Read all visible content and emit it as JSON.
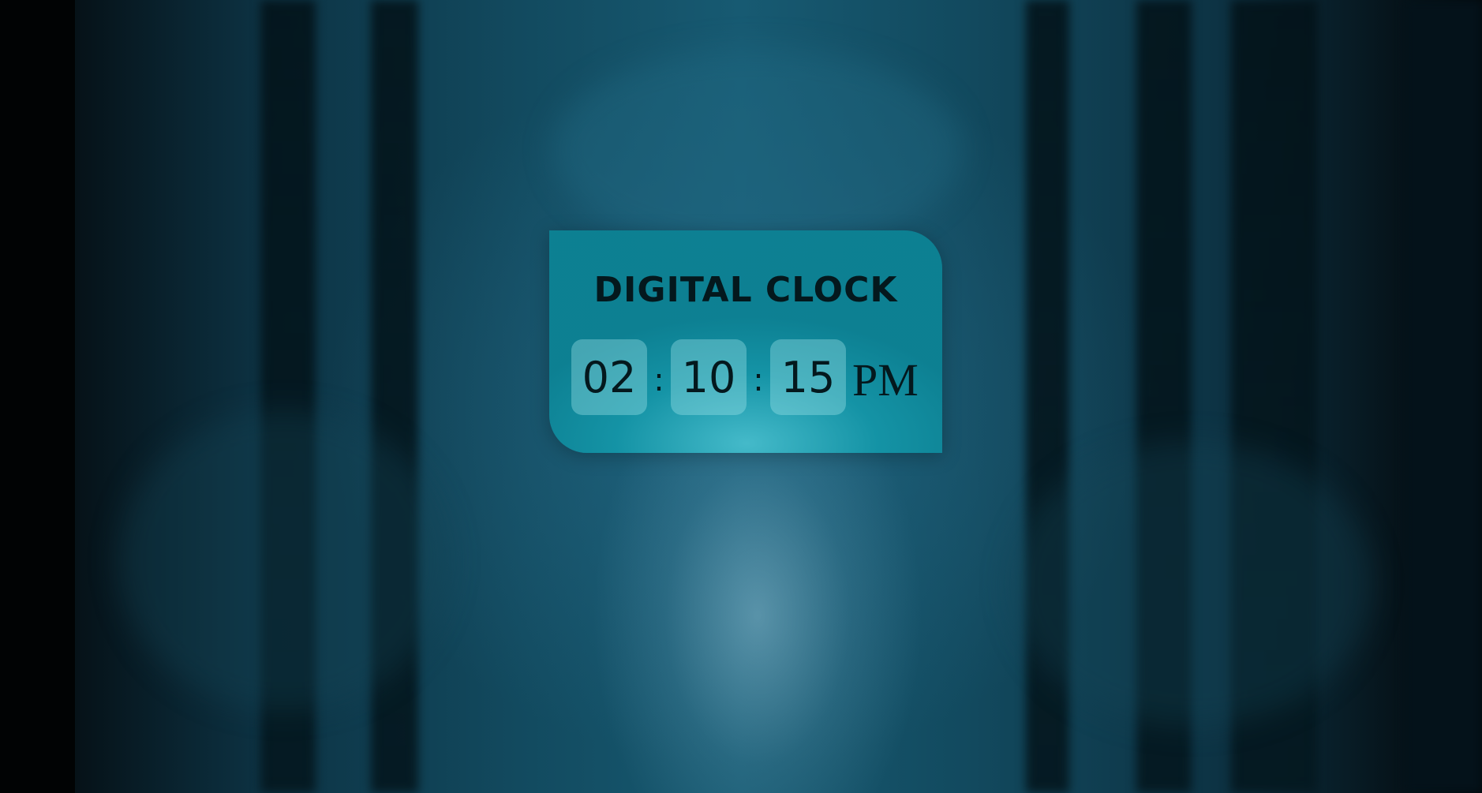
{
  "clock": {
    "title": "DIGITAL CLOCK",
    "hours": "02",
    "minutes": "10",
    "seconds": "15",
    "separator": ":",
    "period": "PM"
  },
  "colors": {
    "card": "#1596a8",
    "digit_box": "#7fcfd6",
    "text": "#04181d",
    "background": "#124a5f"
  }
}
